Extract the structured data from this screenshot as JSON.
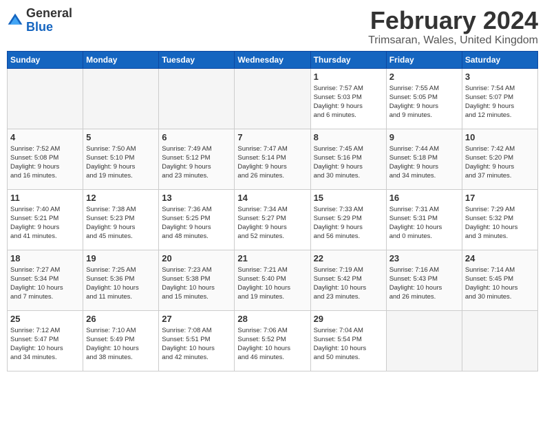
{
  "logo": {
    "general": "General",
    "blue": "Blue"
  },
  "title": "February 2024",
  "subtitle": "Trimsaran, Wales, United Kingdom",
  "days_of_week": [
    "Sunday",
    "Monday",
    "Tuesday",
    "Wednesday",
    "Thursday",
    "Friday",
    "Saturday"
  ],
  "weeks": [
    [
      {
        "day": "",
        "info": ""
      },
      {
        "day": "",
        "info": ""
      },
      {
        "day": "",
        "info": ""
      },
      {
        "day": "",
        "info": ""
      },
      {
        "day": "1",
        "info": "Sunrise: 7:57 AM\nSunset: 5:03 PM\nDaylight: 9 hours\nand 6 minutes."
      },
      {
        "day": "2",
        "info": "Sunrise: 7:55 AM\nSunset: 5:05 PM\nDaylight: 9 hours\nand 9 minutes."
      },
      {
        "day": "3",
        "info": "Sunrise: 7:54 AM\nSunset: 5:07 PM\nDaylight: 9 hours\nand 12 minutes."
      }
    ],
    [
      {
        "day": "4",
        "info": "Sunrise: 7:52 AM\nSunset: 5:08 PM\nDaylight: 9 hours\nand 16 minutes."
      },
      {
        "day": "5",
        "info": "Sunrise: 7:50 AM\nSunset: 5:10 PM\nDaylight: 9 hours\nand 19 minutes."
      },
      {
        "day": "6",
        "info": "Sunrise: 7:49 AM\nSunset: 5:12 PM\nDaylight: 9 hours\nand 23 minutes."
      },
      {
        "day": "7",
        "info": "Sunrise: 7:47 AM\nSunset: 5:14 PM\nDaylight: 9 hours\nand 26 minutes."
      },
      {
        "day": "8",
        "info": "Sunrise: 7:45 AM\nSunset: 5:16 PM\nDaylight: 9 hours\nand 30 minutes."
      },
      {
        "day": "9",
        "info": "Sunrise: 7:44 AM\nSunset: 5:18 PM\nDaylight: 9 hours\nand 34 minutes."
      },
      {
        "day": "10",
        "info": "Sunrise: 7:42 AM\nSunset: 5:20 PM\nDaylight: 9 hours\nand 37 minutes."
      }
    ],
    [
      {
        "day": "11",
        "info": "Sunrise: 7:40 AM\nSunset: 5:21 PM\nDaylight: 9 hours\nand 41 minutes."
      },
      {
        "day": "12",
        "info": "Sunrise: 7:38 AM\nSunset: 5:23 PM\nDaylight: 9 hours\nand 45 minutes."
      },
      {
        "day": "13",
        "info": "Sunrise: 7:36 AM\nSunset: 5:25 PM\nDaylight: 9 hours\nand 48 minutes."
      },
      {
        "day": "14",
        "info": "Sunrise: 7:34 AM\nSunset: 5:27 PM\nDaylight: 9 hours\nand 52 minutes."
      },
      {
        "day": "15",
        "info": "Sunrise: 7:33 AM\nSunset: 5:29 PM\nDaylight: 9 hours\nand 56 minutes."
      },
      {
        "day": "16",
        "info": "Sunrise: 7:31 AM\nSunset: 5:31 PM\nDaylight: 10 hours\nand 0 minutes."
      },
      {
        "day": "17",
        "info": "Sunrise: 7:29 AM\nSunset: 5:32 PM\nDaylight: 10 hours\nand 3 minutes."
      }
    ],
    [
      {
        "day": "18",
        "info": "Sunrise: 7:27 AM\nSunset: 5:34 PM\nDaylight: 10 hours\nand 7 minutes."
      },
      {
        "day": "19",
        "info": "Sunrise: 7:25 AM\nSunset: 5:36 PM\nDaylight: 10 hours\nand 11 minutes."
      },
      {
        "day": "20",
        "info": "Sunrise: 7:23 AM\nSunset: 5:38 PM\nDaylight: 10 hours\nand 15 minutes."
      },
      {
        "day": "21",
        "info": "Sunrise: 7:21 AM\nSunset: 5:40 PM\nDaylight: 10 hours\nand 19 minutes."
      },
      {
        "day": "22",
        "info": "Sunrise: 7:19 AM\nSunset: 5:42 PM\nDaylight: 10 hours\nand 23 minutes."
      },
      {
        "day": "23",
        "info": "Sunrise: 7:16 AM\nSunset: 5:43 PM\nDaylight: 10 hours\nand 26 minutes."
      },
      {
        "day": "24",
        "info": "Sunrise: 7:14 AM\nSunset: 5:45 PM\nDaylight: 10 hours\nand 30 minutes."
      }
    ],
    [
      {
        "day": "25",
        "info": "Sunrise: 7:12 AM\nSunset: 5:47 PM\nDaylight: 10 hours\nand 34 minutes."
      },
      {
        "day": "26",
        "info": "Sunrise: 7:10 AM\nSunset: 5:49 PM\nDaylight: 10 hours\nand 38 minutes."
      },
      {
        "day": "27",
        "info": "Sunrise: 7:08 AM\nSunset: 5:51 PM\nDaylight: 10 hours\nand 42 minutes."
      },
      {
        "day": "28",
        "info": "Sunrise: 7:06 AM\nSunset: 5:52 PM\nDaylight: 10 hours\nand 46 minutes."
      },
      {
        "day": "29",
        "info": "Sunrise: 7:04 AM\nSunset: 5:54 PM\nDaylight: 10 hours\nand 50 minutes."
      },
      {
        "day": "",
        "info": ""
      },
      {
        "day": "",
        "info": ""
      }
    ]
  ]
}
